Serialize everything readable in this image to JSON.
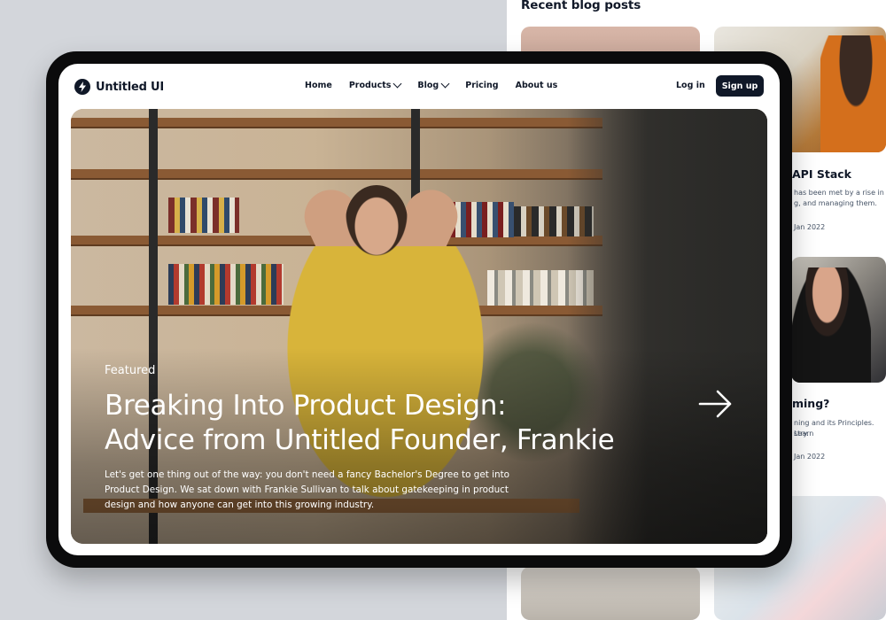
{
  "background": {
    "section_title": "Recent blog posts",
    "card_api_title": "API Stack",
    "card_api_excerpt_1": "has been met by a rise in",
    "card_api_excerpt_2": "g, and managing them.",
    "card_api_date": "Jan 2022",
    "card_two_title": "ming?",
    "card_two_excerpt_1": "ning and its Principles. Learn",
    "card_two_excerpt_2": "stry.",
    "card_two_date": "Jan 2022"
  },
  "nav": {
    "brand": "Untitled UI",
    "items": [
      {
        "label": "Home",
        "has_dropdown": false
      },
      {
        "label": "Products",
        "has_dropdown": true
      },
      {
        "label": "Blog",
        "has_dropdown": true
      },
      {
        "label": "Pricing",
        "has_dropdown": false
      },
      {
        "label": "About us",
        "has_dropdown": false
      }
    ],
    "login_label": "Log in",
    "signup_label": "Sign up"
  },
  "hero": {
    "tag": "Featured",
    "title_line_1": "Breaking Into Product Design:",
    "title_line_2": "Advice from Untitled Founder, Frankie",
    "description": "Let's get one thing out of the way: you don't need a fancy Bachelor's Degree to get into Product Design. We sat down with Frankie Sullivan to talk about gatekeeping in product design and how anyone can get into this growing industry."
  },
  "icons": {
    "logo": "bolt-icon",
    "arrow": "arrow-right-icon",
    "chevron": "chevron-down-icon"
  },
  "colors": {
    "primary": "#101828",
    "text_muted": "#475467",
    "background": "#d3d6db"
  }
}
